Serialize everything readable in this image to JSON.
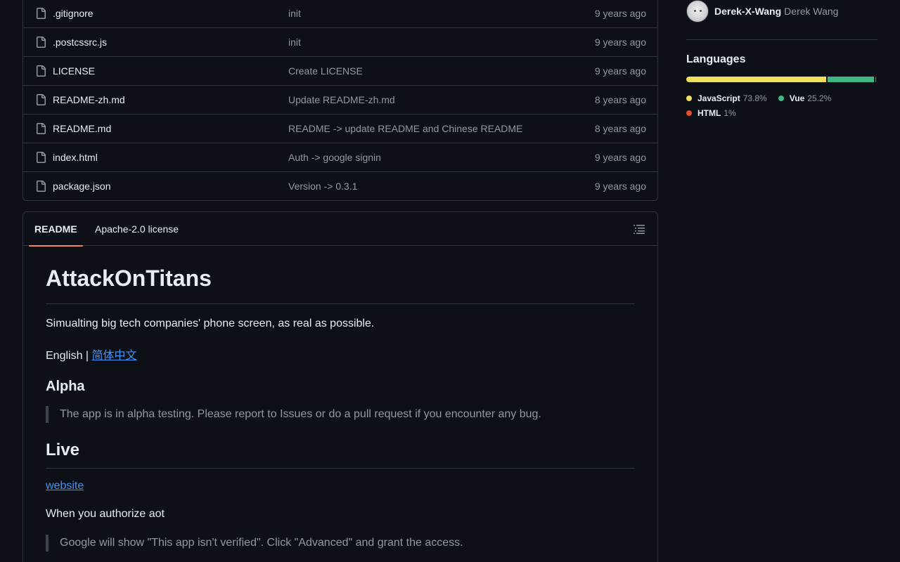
{
  "files": [
    {
      "name": ".gitignore",
      "message": "init",
      "time": "9 years ago"
    },
    {
      "name": ".postcssrc.js",
      "message": "init",
      "time": "9 years ago"
    },
    {
      "name": "LICENSE",
      "message": "Create LICENSE",
      "time": "9 years ago"
    },
    {
      "name": "README-zh.md",
      "message": "Update README-zh.md",
      "time": "8 years ago"
    },
    {
      "name": "README.md",
      "message": "README -> update README and Chinese README",
      "time": "8 years ago"
    },
    {
      "name": "index.html",
      "message": "Auth -> google signin",
      "time": "9 years ago"
    },
    {
      "name": "package.json",
      "message": "Version -> 0.3.1",
      "time": "9 years ago"
    }
  ],
  "readme": {
    "tabs": {
      "readme": "README",
      "license": "Apache-2.0 license"
    },
    "title": "AttackOnTitans",
    "tagline": "Simualting big tech companies' phone screen, as real as possible.",
    "lang_prefix": "English | ",
    "lang_link": "简体中文",
    "alpha_heading": "Alpha",
    "alpha_quote": "The app is in alpha testing. Please report to Issues or do a pull request if you encounter any bug.",
    "live_heading": "Live",
    "website_link": "website",
    "authorize_text": "When you authorize aot",
    "google_quote": "Google will show \"This app isn't verified\". Click \"Advanced\" and grant the access."
  },
  "sidebar": {
    "contributor": {
      "login": "Derek-X-Wang",
      "name": "Derek Wang"
    },
    "languages_title": "Languages",
    "languages": [
      {
        "name": "JavaScript",
        "percent": "73.8%",
        "value": 73.8,
        "color": "#f1e05a"
      },
      {
        "name": "Vue",
        "percent": "25.2%",
        "value": 25.2,
        "color": "#41b883"
      },
      {
        "name": "HTML",
        "percent": "1%",
        "value": 1.0,
        "color": "#e34c26"
      }
    ]
  }
}
